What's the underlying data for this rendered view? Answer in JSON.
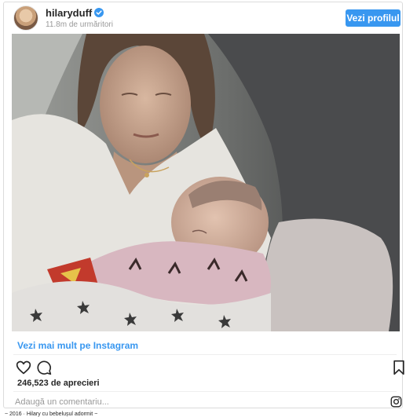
{
  "post": {
    "username": "hilaryduff",
    "followers": "11.8m de urmăritori",
    "follow_button": "Vezi profilul",
    "photo_alt": "",
    "see_more": "Vezi mai mult pe Instagram",
    "likes": "246,523 de aprecieri",
    "comment_placeholder": "Adaugă un comentariu...",
    "caption": "~ 2016 · Hilary cu bebelușul adormit ~"
  },
  "icons": {
    "avatar": "profile-avatar",
    "verified": "verified-badge-icon",
    "like": "heart-icon",
    "comment": "comment-bubble-icon",
    "save": "bookmark-icon",
    "brand": "instagram-logo-icon"
  },
  "colors": {
    "accent": "#3897f0",
    "text": "#262626",
    "muted": "#999999",
    "border": "#dbdbdb"
  }
}
